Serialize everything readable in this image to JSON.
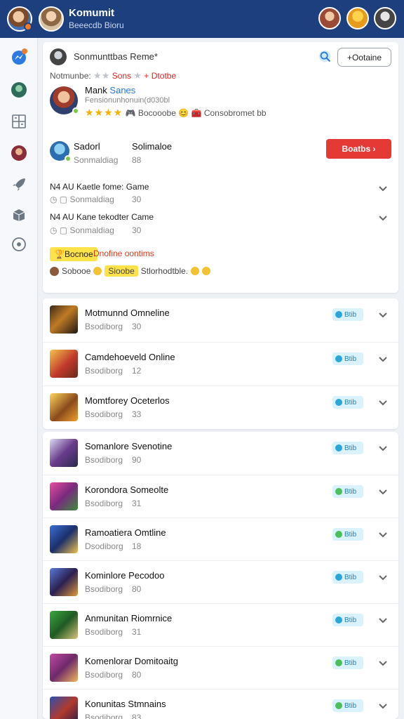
{
  "header": {
    "title": "Komumit",
    "subtitle": "Beeecdb Bioru"
  },
  "top": {
    "heading": "Sonmunttbas Reme*",
    "online_button": "+Ootaine",
    "meta": {
      "label": "Notmunbe:",
      "stars": "★★",
      "sons": "Sons",
      "star_after": "★",
      "plus": "+",
      "status": "Dtotbe"
    },
    "user": {
      "name": "Mank",
      "name_highlight": "Sanes",
      "subtitle": "Fensionunhonuin(d030bl",
      "stars": "★★★★",
      "rating_text1": "Bocooobe",
      "rating_text2": "Consobromet bb"
    },
    "row2": {
      "label": "Sadorl",
      "col": "Solimaloe",
      "sub": "Sonmaldiag",
      "num": "88",
      "button": "Boatbs ›"
    },
    "games": [
      {
        "title": "N4 AU  Kaetle fome: Game",
        "sub": "Sonmaldiag",
        "num": "30"
      },
      {
        "title": "N4 AU  Kane tekodter Came",
        "sub": "Sonmaldiag",
        "num": "30"
      }
    ],
    "badge": "Bocnoe",
    "badge_label": "Dnofine oontims",
    "emoji_row": {
      "text1": "Sobooe",
      "tag": "Sioobe",
      "text2": "Stlorhodtble."
    }
  },
  "list1": [
    {
      "name": "Motmunnd Omneline",
      "sub": "Bsodiborg",
      "num": "30",
      "pill": "Btib",
      "green": false
    },
    {
      "name": "Camdehoeveld Online",
      "sub": "Bsodiborg",
      "num": "12",
      "pill": "Btib",
      "green": false
    },
    {
      "name": "Momtforey Oceterlos",
      "sub": "Bsodiborg",
      "num": "33",
      "pill": "Btib",
      "green": false
    }
  ],
  "list2": [
    {
      "name": "Somanlore Svenotine",
      "sub": "Bsodiborg",
      "num": "90",
      "pill": "Btib",
      "green": false
    },
    {
      "name": "Korondora Someolte",
      "sub": "Bsodiborg",
      "num": "31",
      "pill": "Btib",
      "green": true
    },
    {
      "name": "Ramoatiera Omtline",
      "sub": "Dsodiborg",
      "num": "18",
      "pill": "Btib",
      "green": true
    },
    {
      "name": "Kominlore Pecodoo",
      "sub": "Bsodiborg",
      "num": "80",
      "pill": "Btib",
      "green": false
    },
    {
      "name": "Anmunitan Riomrnice",
      "sub": "Bsodiborg",
      "num": "31",
      "pill": "Btib",
      "green": false
    },
    {
      "name": "Komenlorar Domitoaitg",
      "sub": "Bsodiborg",
      "num": "80",
      "pill": "Btib",
      "green": true
    },
    {
      "name": "Konunitas Stmnains",
      "sub": "Bsodiborg",
      "num": "83",
      "pill": "Btib",
      "green": true
    }
  ],
  "icons": {
    "sidebar": [
      "messenger-icon",
      "avatar-icon",
      "grid-icon",
      "avatar-icon",
      "rocket-icon",
      "cube-icon",
      "compass-icon"
    ],
    "accent": "#1d3f7e",
    "danger": "#e53935"
  }
}
